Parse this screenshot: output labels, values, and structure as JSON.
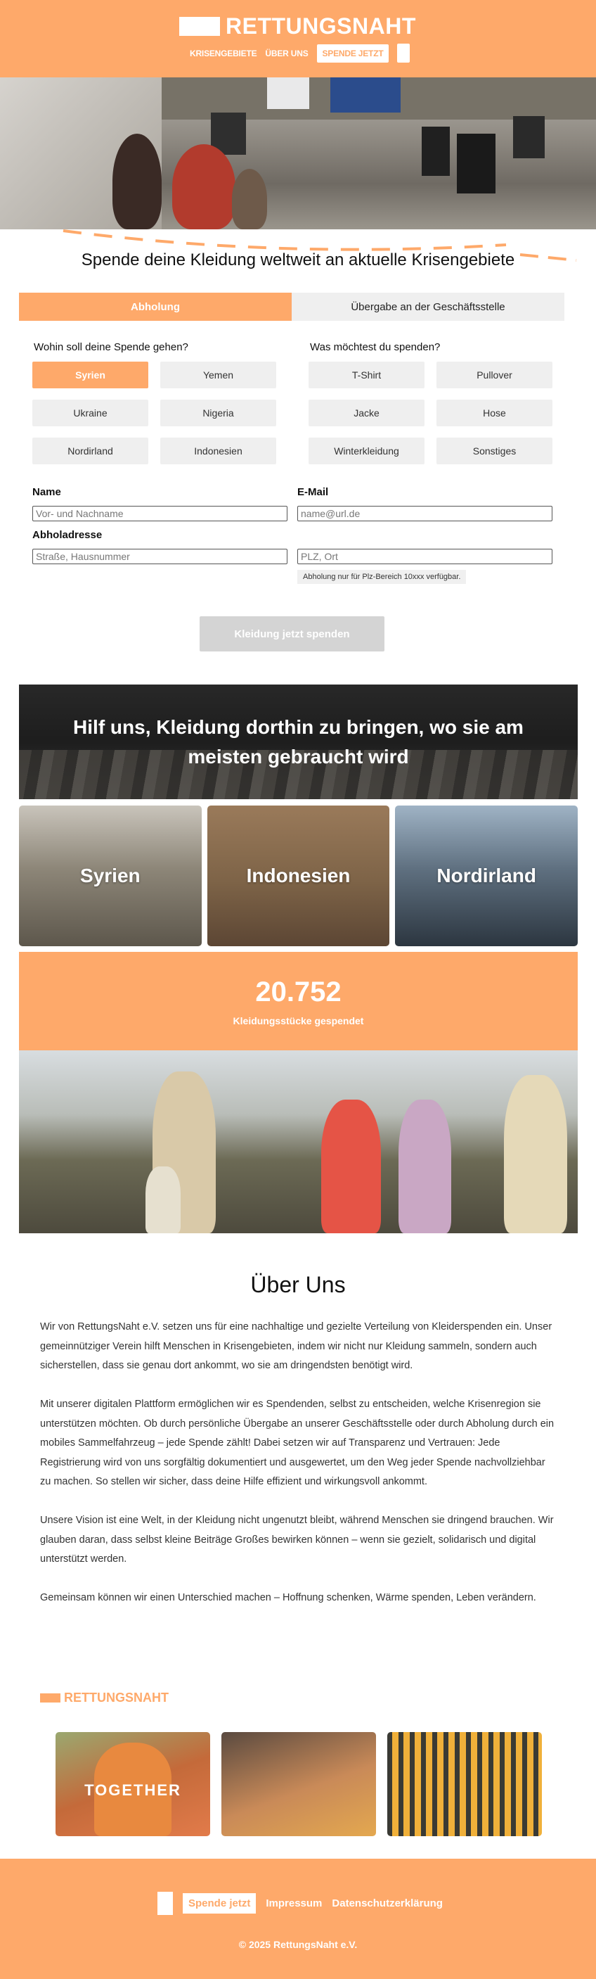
{
  "header": {
    "logo_text": "RETTUNGSNAHT",
    "nav": [
      "KRISENGEBIETE",
      "ÜBER UNS"
    ],
    "cta": "SPENDE JETZT"
  },
  "donate": {
    "title": "Spende deine Kleidung weltweit an aktuelle Krisengebiete",
    "tabs": [
      "Abholung",
      "Übergabe an der Geschäftsstelle"
    ],
    "where_label": "Wohin soll deine Spende gehen?",
    "where_options": [
      "Syrien",
      "Yemen",
      "Ukraine",
      "Nigeria",
      "Nordirland",
      "Indonesien"
    ],
    "where_selected": "Syrien",
    "what_label": "Was möchtest du spenden?",
    "what_options": [
      "T-Shirt",
      "Pullover",
      "Jacke",
      "Hose",
      "Winterkleidung",
      "Sonstiges"
    ],
    "name_label": "Name",
    "name_placeholder": "Vor- und Nachname",
    "email_label": "E-Mail",
    "email_placeholder": "name@url.de",
    "address_label": "Abholadresse",
    "street_placeholder": "Straße, Hausnummer",
    "plz_placeholder": "PLZ, Ort",
    "note": "Abholung nur für Plz-Bereich 10xxx verfügbar.",
    "submit": "Kleidung jetzt spenden"
  },
  "help": {
    "title": "Hilf uns, Kleidung dorthin zu bringen, wo sie am meisten gebraucht wird",
    "regions": [
      "Syrien",
      "Indonesien",
      "Nordirland"
    ]
  },
  "stats": {
    "number": "20.752",
    "label": "Kleidungsstücke gespendet"
  },
  "about": {
    "title": "Über Uns",
    "paragraphs": [
      "Wir von RettungsNaht e.V. setzen uns für eine nachhaltige und gezielte Verteilung von Kleiderspenden ein. Unser gemeinnütziger Verein hilft Menschen in Krisengebieten, indem wir nicht nur Kleidung sammeln, sondern auch sicherstellen, dass sie genau dort ankommt, wo sie am dringendsten benötigt wird.",
      "Mit unserer digitalen Plattform ermöglichen wir es Spendenden, selbst zu entscheiden, welche Krisenregion sie unterstützen möchten. Ob durch persönliche Übergabe an unserer Geschäftsstelle oder durch Abholung durch ein mobiles Sammelfahrzeug – jede Spende zählt! Dabei setzen wir auf Transparenz und Vertrauen: Jede Registrierung wird von uns sorgfältig dokumentiert und ausgewertet, um den Weg jeder Spende nachvollziehbar zu machen. So stellen wir sicher, dass deine Hilfe effizient und wirkungsvoll ankommt.",
      "Unsere Vision ist eine Welt, in der Kleidung nicht ungenutzt bleibt, während Menschen sie dringend brauchen. Wir glauben daran, dass selbst kleine Beiträge Großes bewirken können – wenn sie gezielt, solidarisch und digital unterstützt werden.",
      "Gemeinsam können wir einen Unterschied machen – Hoffnung schenken, Wärme spenden, Leben verändern."
    ],
    "brand": "RETTUNGSNAHT",
    "gallery_text": "TOGETHER"
  },
  "footer": {
    "cta": "Spende jetzt",
    "links": [
      "Impressum",
      "Datenschutzerklärung"
    ],
    "copyright": "© 2025 RettungsNaht e.V."
  },
  "colors": {
    "accent": "#fea96a",
    "muted": "#efefef",
    "disabled": "#d4d4d4"
  }
}
